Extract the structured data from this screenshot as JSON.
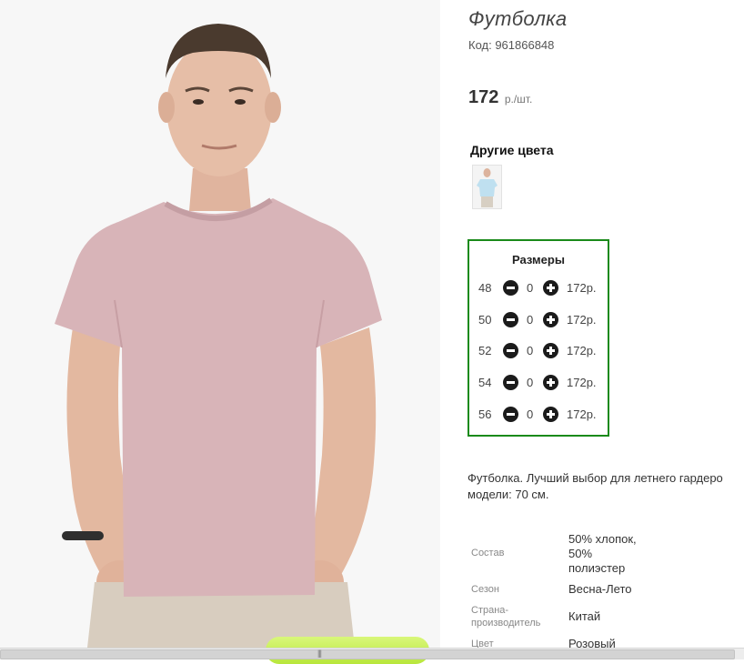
{
  "product": {
    "title": "Футболка",
    "code": "Код: 961866848",
    "price": "172",
    "price_unit": "р./шт.",
    "photo_icon": "tshirt-model-photo"
  },
  "other_colors": {
    "title": "Другие цвета",
    "thumbnails": [
      {
        "icon": "light-blue-tshirt-thumbnail"
      }
    ]
  },
  "sizes": {
    "title": "Размеры",
    "rows": [
      {
        "size": "48",
        "qty": "0",
        "price": "172р."
      },
      {
        "size": "50",
        "qty": "0",
        "price": "172р."
      },
      {
        "size": "52",
        "qty": "0",
        "price": "172р."
      },
      {
        "size": "54",
        "qty": "0",
        "price": "172р."
      },
      {
        "size": "56",
        "qty": "0",
        "price": "172р."
      }
    ],
    "accent_color": "#1a8a1a"
  },
  "description": {
    "line1": "Футболка. Лучший выбор для летнего гардеро",
    "line2": "модели: 70 см."
  },
  "specs": [
    {
      "label": "Состав",
      "value_lines": [
        "50% хлопок,",
        "50%",
        "полиэстер"
      ]
    },
    {
      "label": "Сезон",
      "value_lines": [
        "Весна-Лето"
      ]
    },
    {
      "label_lines": [
        "Страна-",
        "производитель"
      ],
      "value_lines": [
        "Китай"
      ]
    },
    {
      "label": "Цвет",
      "value_lines": [
        "Розовый"
      ]
    }
  ],
  "cart_button": {
    "label": ""
  }
}
